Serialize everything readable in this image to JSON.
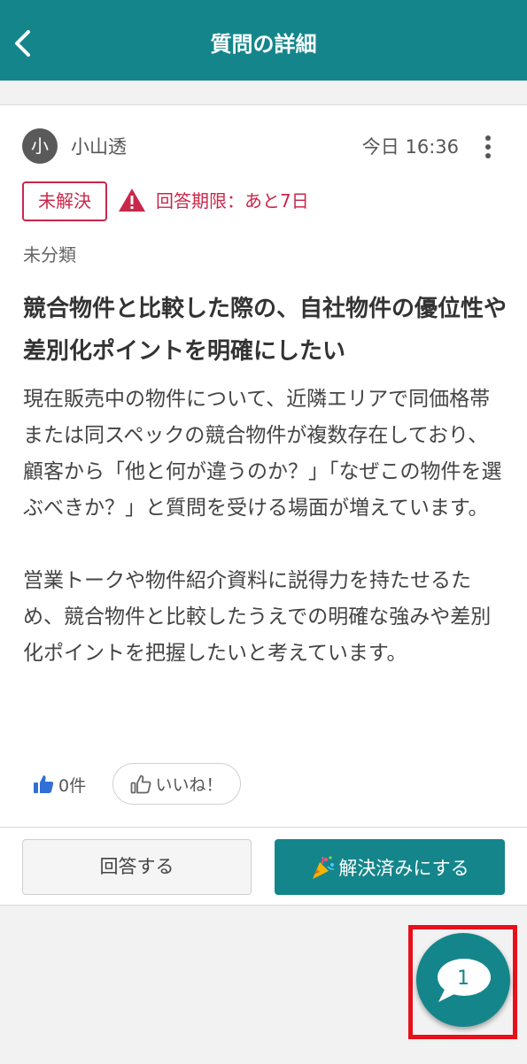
{
  "header": {
    "title": "質問の詳細",
    "back_icon": "chevron-left-icon",
    "background": "#14868b"
  },
  "question": {
    "author": {
      "avatar_initial": "小",
      "name": "小山透"
    },
    "timestamp": "今日 16:36",
    "status": "未解決",
    "deadline": "回答期限：あと7日",
    "category": "未分類",
    "title": "競合物件と比較した際の、自社物件の優位性や差別化ポイントを明確にしたい",
    "body": "現在販売中の物件について、近隣エリアで同価格帯または同スペックの競合物件が複数存在しており、顧客から「他と何が違うのか？」「なぜこの物件を選ぶべきか？」と質問を受ける場面が増えています。\n\n営業トークや物件紹介資料に説得力を持たせるため、競合物件と比較したうえでの明確な強みや差別化ポイントを把握したいと考えています。",
    "likes": {
      "count_label": "0件",
      "button_label": "いいね！"
    }
  },
  "actions": {
    "answer_label": "回答する",
    "resolve_label": "解決済みにする",
    "resolve_icon": "party-popper-icon"
  },
  "fab": {
    "count": "1",
    "icon": "speech-bubble-icon"
  },
  "colors": {
    "accent": "#14868b",
    "alert": "#c8284b",
    "highlight": "#e8101a"
  }
}
